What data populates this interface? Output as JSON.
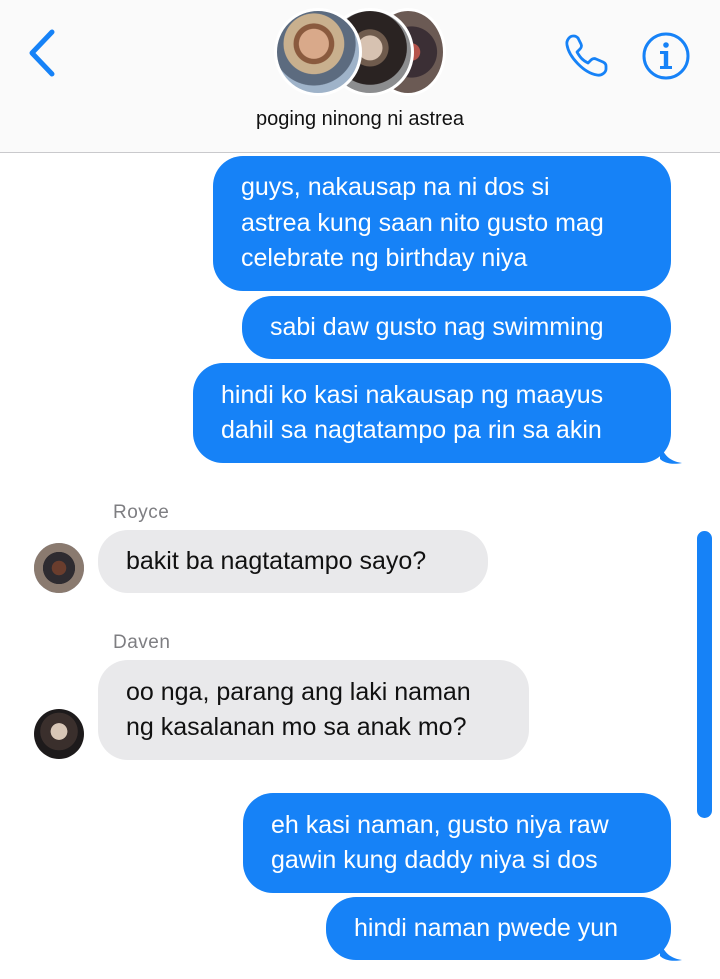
{
  "header": {
    "group_name": "poging ninong ni astrea",
    "icons": {
      "back": "chevron-left-icon",
      "call": "phone-icon",
      "info": "info-icon"
    },
    "accent_color": "#1682f7"
  },
  "messages": [
    {
      "direction": "outgoing",
      "text": "guys, nakausap na ni dos si\nastrea kung saan nito gusto mag\ncelebrate ng birthday niya"
    },
    {
      "direction": "outgoing",
      "text": "sabi daw gusto nag swimming"
    },
    {
      "direction": "outgoing",
      "text": "hindi ko kasi nakausap ng maayus\ndahil sa nagtatampo pa rin sa akin"
    },
    {
      "direction": "incoming",
      "sender": "Royce",
      "text": "bakit ba nagtatampo sayo?"
    },
    {
      "direction": "incoming",
      "sender": "Daven",
      "text": "oo nga, parang ang laki naman\nng kasalanan mo sa anak mo?"
    },
    {
      "direction": "outgoing",
      "text": "eh kasi naman, gusto niya raw\ngawin kung daddy niya si dos"
    },
    {
      "direction": "outgoing",
      "text": "hindi naman pwede yun"
    }
  ],
  "colors": {
    "outgoing_bubble": "#1682f7",
    "incoming_bubble": "#e9e9eb",
    "sender_label": "#7e7e82"
  }
}
